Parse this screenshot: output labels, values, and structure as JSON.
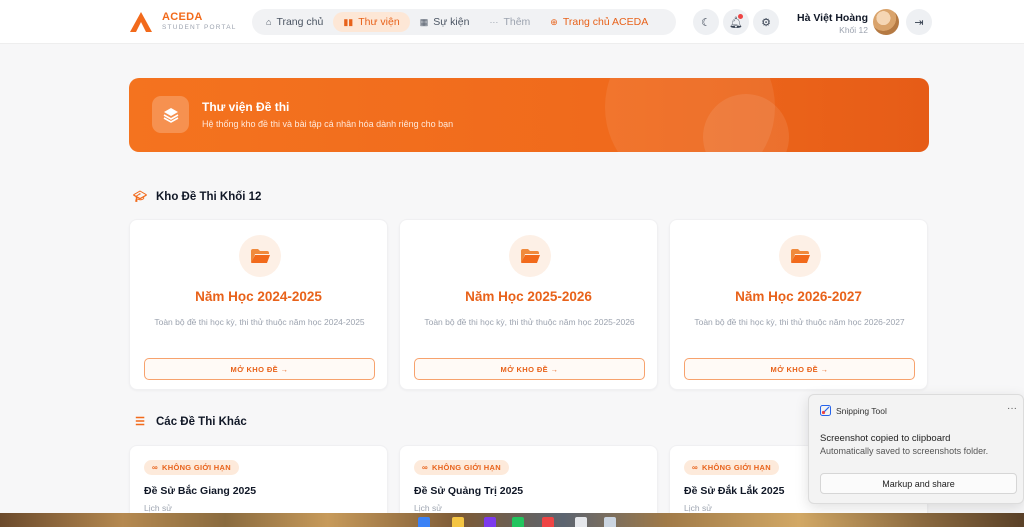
{
  "header": {
    "brand_title": "ACEDA",
    "brand_subtitle": "STUDENT PORTAL",
    "nav": [
      {
        "label": "Trang chủ",
        "icon": "home-icon"
      },
      {
        "label": "Thư viện",
        "icon": "book-icon",
        "active": true
      },
      {
        "label": "Sự kiện",
        "icon": "calendar-icon"
      },
      {
        "label": "Thêm",
        "icon": "more-icon"
      },
      {
        "label": "Trang chủ ACEDA",
        "icon": "globe-icon"
      }
    ],
    "user_name": "Hà Việt Hoàng",
    "user_grade": "Khối 12",
    "icons": [
      "moon-icon",
      "bell-icon",
      "gear-icon",
      "logout-icon"
    ]
  },
  "hero": {
    "title": "Thư viện Đề thi",
    "subtitle": "Hệ thống kho đề thi và bài tập cá nhân hóa dành riêng cho bạn",
    "icon": "layers-icon"
  },
  "grade_section": {
    "title": "Kho Đề Thi Khối 12",
    "icon": "graduation-cap-icon",
    "cards": [
      {
        "year": "Năm Học 2024-2025",
        "desc": "Toàn bộ đề thi học kỳ, thi thử thuộc năm học 2024-2025",
        "button": "MỞ KHO ĐỀ →"
      },
      {
        "year": "Năm Học 2025-2026",
        "desc": "Toàn bộ đề thi học kỳ, thi thử thuộc năm học 2025-2026",
        "button": "MỞ KHO ĐỀ →"
      },
      {
        "year": "Năm Học 2026-2027",
        "desc": "Toàn bộ đề thi học kỳ, thi thử thuộc năm học 2026-2027",
        "button": "MỞ KHO ĐỀ →"
      }
    ]
  },
  "other_section": {
    "title": "Các Đề Thi Khác",
    "icon": "list-icon",
    "cards": [
      {
        "tag": "KHÔNG GIỚI HẠN",
        "title": "Đề Sử Bắc Giang 2025",
        "subject": "Lịch sử"
      },
      {
        "tag": "KHÔNG GIỚI HẠN",
        "title": "Đề Sử Quảng Trị 2025",
        "subject": "Lịch sử"
      },
      {
        "tag": "KHÔNG GIỚI HẠN",
        "title": "Đề Sử Đắk Lắk 2025",
        "subject": "Lịch sử"
      }
    ]
  },
  "toast": {
    "app": "Snipping Tool",
    "title": "Screenshot copied to clipboard",
    "body": "Automatically saved to screenshots folder.",
    "button": "Markup and share",
    "more": "···"
  },
  "colors": {
    "accent": "#f26a1b",
    "accent_light": "#fde7d6",
    "page_bg": "#f7f7f8"
  }
}
